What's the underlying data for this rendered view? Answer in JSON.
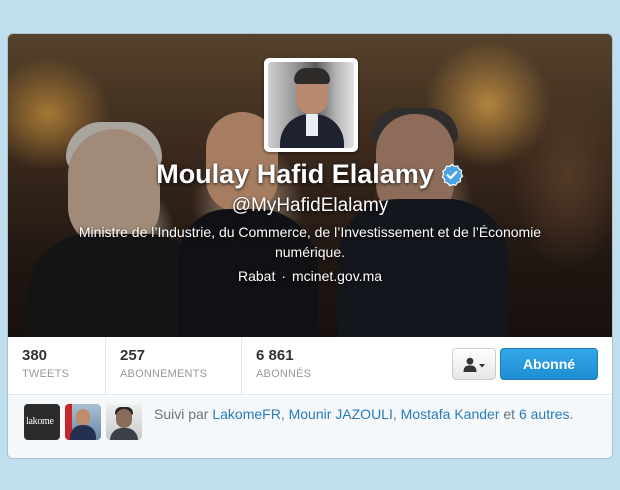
{
  "profile": {
    "name": "Moulay Hafid Elalamy",
    "handle": "@MyHafidElalamy",
    "bio": "Ministre de l’Industrie, du Commerce, de l’Investissement et de l’Économie numérique.",
    "location": "Rabat",
    "separator": "·",
    "website": "mcinet.gov.ma",
    "verified_icon": "verified-badge-icon",
    "avatar_icon": "profile-photo"
  },
  "stats": [
    {
      "value": "380",
      "label": "TWEETS"
    },
    {
      "value": "257",
      "label": "ABONNEMENTS"
    },
    {
      "value": "6 861",
      "label": "ABONNÉS"
    }
  ],
  "actions": {
    "user_dropdown_icon": "user-dropdown-icon",
    "follow_label": "Abonné"
  },
  "followed_by": {
    "prefix": "Suivi par",
    "users": [
      "LakomeFR",
      "Mounir JAZOULI",
      "Mostafa Kander"
    ],
    "sep1": ",",
    "sep2": ",",
    "conjunction": "et",
    "others": "6 autres",
    "end": ".",
    "thumb1_text": "lakome"
  },
  "colors": {
    "page_bg": "#c0deed",
    "accent": "#2b7bb9",
    "follow_button": "#1f8ed3",
    "verified": "#4ba3e3"
  }
}
